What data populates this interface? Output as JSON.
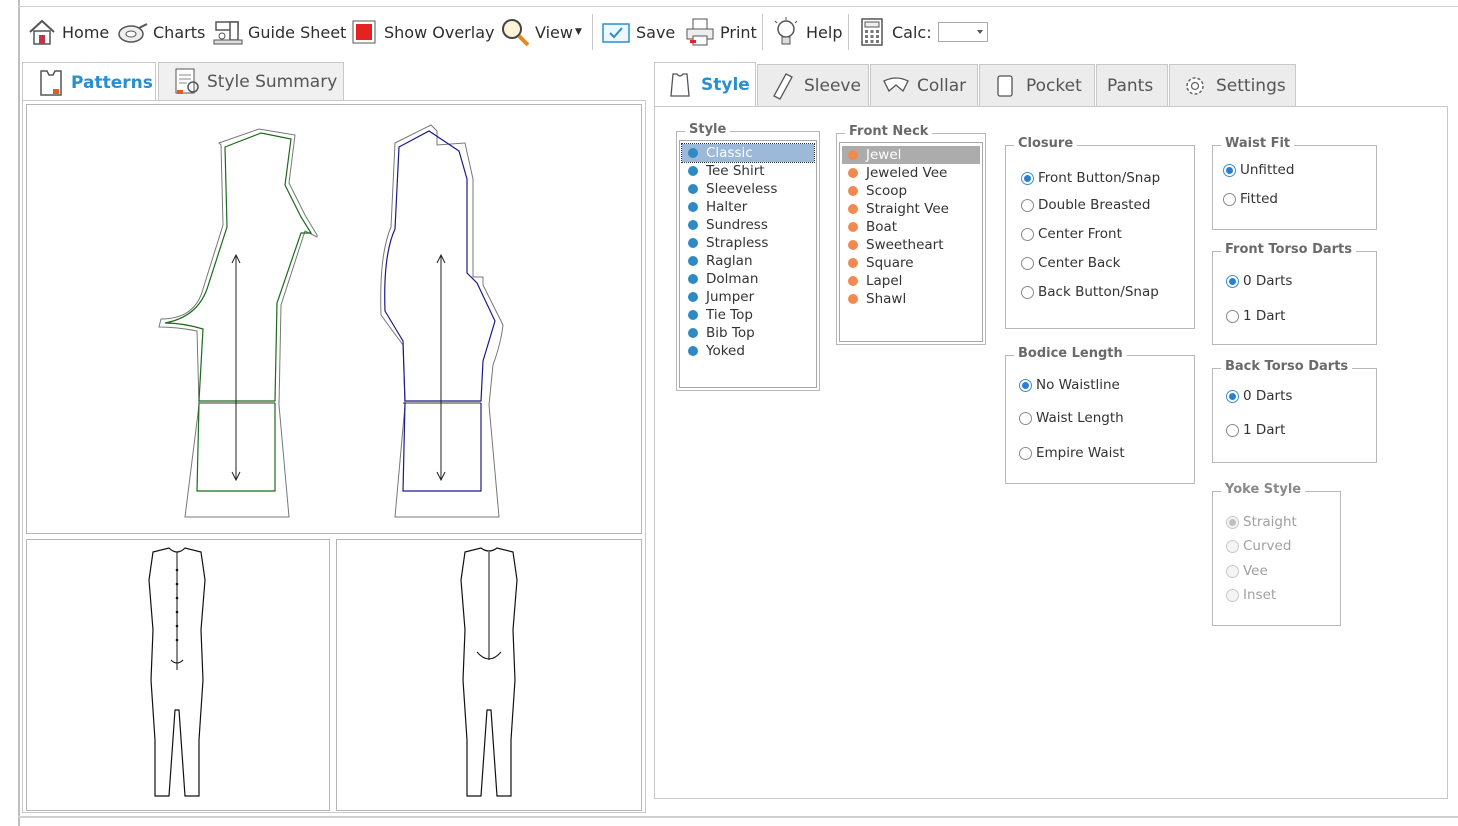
{
  "toolbar": {
    "home": "Home",
    "charts": "Charts",
    "guide_sheet": "Guide Sheet",
    "show_overlay": "Show Overlay",
    "view": "View",
    "save": "Save",
    "print": "Print",
    "help": "Help",
    "calc_label": "Calc:",
    "calc_value": ""
  },
  "left_tabs": {
    "patterns": "Patterns",
    "style_summary": "Style Summary"
  },
  "right_tabs": {
    "style": "Style",
    "sleeve": "Sleeve",
    "collar": "Collar",
    "pocket": "Pocket",
    "pants": "Pants",
    "settings": "Settings"
  },
  "style_group": {
    "title": "Style",
    "selected": "Classic",
    "items": [
      "Classic",
      "Tee Shirt",
      "Sleeveless",
      "Halter",
      "Sundress",
      "Strapless",
      "Raglan",
      "Dolman",
      "Jumper",
      "Tie Top",
      "Bib Top",
      "Yoked"
    ]
  },
  "front_neck_group": {
    "title": "Front Neck",
    "selected": "Jewel",
    "items": [
      "Jewel",
      "Jeweled Vee",
      "Scoop",
      "Straight Vee",
      "Boat",
      "Sweetheart",
      "Square",
      "Lapel",
      "Shawl"
    ]
  },
  "closure_group": {
    "title": "Closure",
    "selected": "Front Button/Snap",
    "options": [
      "Front Button/Snap",
      "Double Breasted",
      "Center Front",
      "Center Back",
      "Back Button/Snap"
    ]
  },
  "bodice_length_group": {
    "title": "Bodice Length",
    "selected": "No Waistline",
    "options": [
      "No Waistline",
      "Waist Length",
      "Empire Waist"
    ]
  },
  "waist_fit_group": {
    "title": "Waist Fit",
    "selected": "Unfitted",
    "options": [
      "Unfitted",
      "Fitted"
    ]
  },
  "front_torso_darts_group": {
    "title": "Front Torso Darts",
    "selected": "0 Darts",
    "options": [
      "0 Darts",
      "1 Dart"
    ]
  },
  "back_torso_darts_group": {
    "title": "Back Torso Darts",
    "selected": "0 Darts",
    "options": [
      "0 Darts",
      "1 Dart"
    ]
  },
  "yoke_style_group": {
    "title": "Yoke Style",
    "selected": "Straight",
    "enabled": false,
    "options": [
      "Straight",
      "Curved",
      "Vee",
      "Inset"
    ]
  },
  "colors": {
    "accent": "#2a8fd0",
    "style_dot": "#2f8ac4",
    "neck_dot": "#f08a50",
    "front_pattern": "#1a6b1a",
    "back_pattern": "#1a1a8a"
  },
  "icons": {
    "home": "home-icon",
    "charts": "measuring-tape-icon",
    "guide_sheet": "sewing-machine-icon",
    "show_overlay": "red-square-icon",
    "view": "magnifier-icon",
    "save": "save-check-icon",
    "print": "printer-icon",
    "help": "lightbulb-icon",
    "calc": "calculator-icon"
  }
}
